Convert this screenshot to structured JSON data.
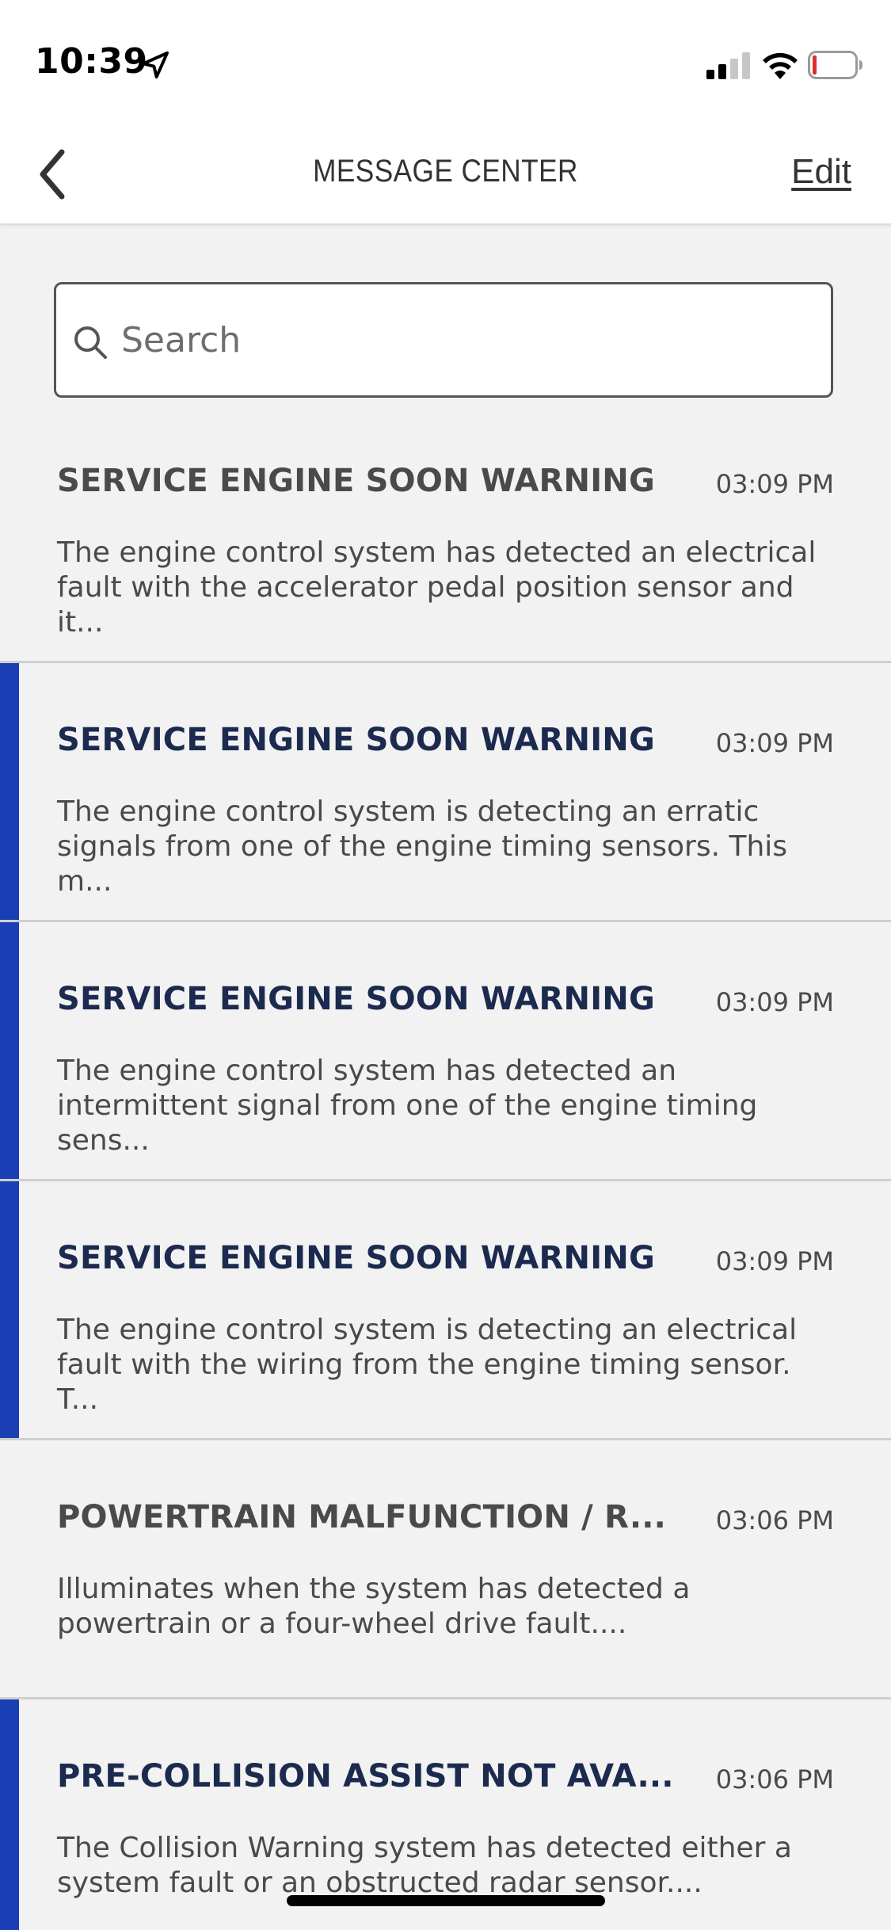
{
  "status_bar": {
    "time": "10:39",
    "icons": [
      "location-arrow-icon",
      "cellular-signal-icon",
      "wifi-icon",
      "battery-icon"
    ]
  },
  "nav": {
    "back_icon": "chevron-left-icon",
    "title": "MESSAGE CENTER",
    "edit_label": "Edit"
  },
  "search": {
    "placeholder": "Search",
    "value": "",
    "icon": "search-icon"
  },
  "colors": {
    "unread_accent": "#1a3fb5",
    "unread_title": "#1b2a4e",
    "read_title": "#4a4a4a"
  },
  "messages": [
    {
      "title": "SERVICE ENGINE SOON WARNING",
      "time": "03:09 PM",
      "body": "The engine control system has detected an electrical\nfault with the accelerator pedal position sensor and it...",
      "unread": false
    },
    {
      "title": "SERVICE ENGINE SOON WARNING",
      "time": "03:09 PM",
      "body": "The engine control system is detecting an erratic\nsignals from one of the engine timing sensors. This m...",
      "unread": true
    },
    {
      "title": "SERVICE ENGINE SOON WARNING",
      "time": "03:09 PM",
      "body": "The engine control system has detected an\nintermittent signal from one of the engine timing sens...",
      "unread": true
    },
    {
      "title": "SERVICE ENGINE SOON WARNING",
      "time": "03:09 PM",
      "body": "The engine control system is detecting an electrical\nfault with the wiring from the engine timing sensor. T...",
      "unread": true
    },
    {
      "title": "POWERTRAIN MALFUNCTION / R...",
      "time": "03:06 PM",
      "body": "Illuminates when the system has detected a\npowertrain or a four-wheel drive fault....",
      "unread": false
    },
    {
      "title": "PRE-COLLISION ASSIST NOT AVA...",
      "time": "03:06 PM",
      "body": "The Collision Warning system has detected either a\nsystem fault or an obstructed radar sensor....",
      "unread": true
    }
  ]
}
